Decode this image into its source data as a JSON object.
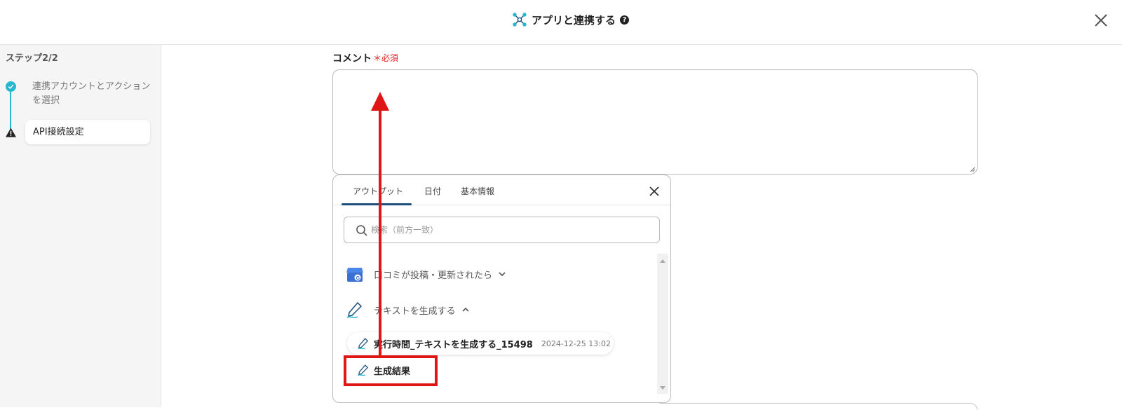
{
  "header": {
    "title": "アプリと連携する",
    "help": "?"
  },
  "sidebar": {
    "step_count": "ステップ2/2",
    "steps": [
      {
        "label": "連携アカウントとアクションを選択",
        "status": "done"
      },
      {
        "label": "API接続設定",
        "status": "warning"
      }
    ]
  },
  "form": {
    "comment_label": "コメント",
    "required_label": "＊必須",
    "comment_value": ""
  },
  "output_panel": {
    "tabs": [
      {
        "label": "アウトプット",
        "active": true
      },
      {
        "label": "日付",
        "active": false
      },
      {
        "label": "基本情報",
        "active": false
      }
    ],
    "search": {
      "placeholder": "検索（前方一致）",
      "value": ""
    },
    "groups": [
      {
        "label": "口コミが投稿・更新されたら",
        "expanded": false,
        "icon": "google-business-icon"
      },
      {
        "label": "テキストを生成する",
        "expanded": true,
        "icon": "pen-icon"
      }
    ],
    "items": [
      {
        "name": "実行時間_テキストを生成する_15498",
        "time": "2024-12-25 13:02"
      },
      {
        "name": "生成結果",
        "time": ""
      }
    ]
  },
  "colors": {
    "accent": "#27b7cf",
    "tab_underline": "#1d4f7c",
    "annotation": "#e01616",
    "required": "#e02020"
  }
}
